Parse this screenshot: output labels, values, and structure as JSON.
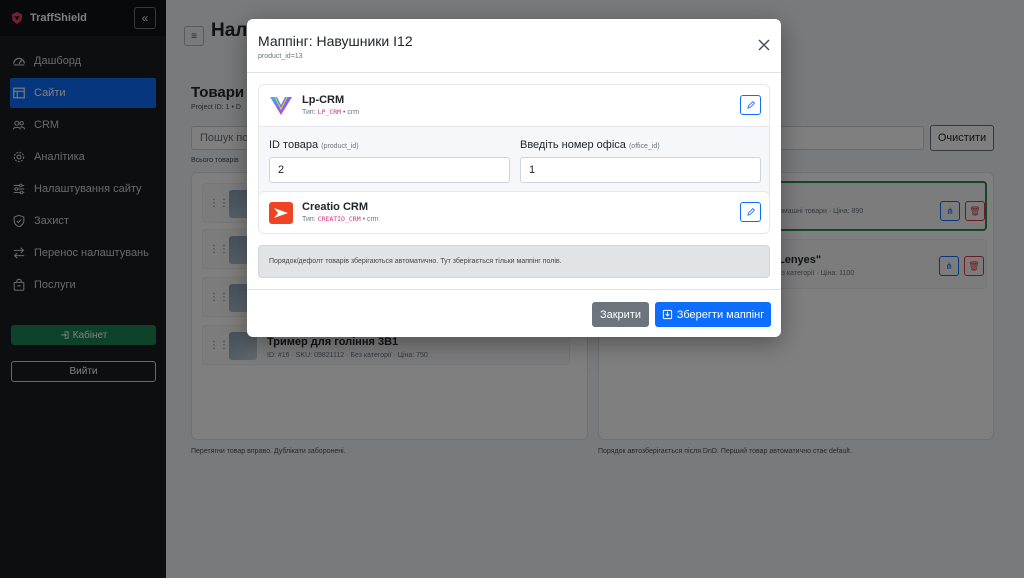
{
  "brand": {
    "name": "TraffShield",
    "collapse": "«"
  },
  "sidebar": {
    "items": [
      {
        "label": "Дашборд",
        "icon": "dashboard-icon"
      },
      {
        "label": "Сайти",
        "icon": "table-icon",
        "active": true
      },
      {
        "label": "CRM",
        "icon": "users-icon"
      },
      {
        "label": "Аналітика",
        "icon": "gear-icon"
      },
      {
        "label": "Налаштування сайту",
        "icon": "sliders-icon"
      },
      {
        "label": "Захист",
        "icon": "shield-icon"
      },
      {
        "label": "Перенос налаштувань",
        "icon": "transfer-icon"
      },
      {
        "label": "Послуги",
        "icon": "bag-icon"
      }
    ],
    "cabinet_label": "Кабінет",
    "logout_label": "Вийти"
  },
  "main": {
    "menu_glyph": "≡",
    "page_title": "Нала",
    "section_title": "Товари",
    "project_meta": "Project ID: 1 • D",
    "search_placeholder": "Пошук по",
    "clear_label": "Очистити",
    "total_text": "Всього товарів",
    "left_note": "Перетягни товар вправо. Дублікати заборонені.",
    "right_note": "Порядок автозберігається після DnD. Перший товар автоматично стає default.",
    "left_products": [
      {
        "name": "",
        "meta": ""
      },
      {
        "name": "",
        "meta": ""
      },
      {
        "name": "",
        "meta": ""
      },
      {
        "name": "Тример для гоління 3В1",
        "meta": "ID: #16   ·   SKU: 09821112   ·   Без категорії   ·   Ціна: 750"
      }
    ],
    "right_products": [
      {
        "name": "",
        "meta": "омашні товари   ·   Ціна: 890"
      },
      {
        "name": "Lenyes\"",
        "meta": "ез категорії   ·   Ціна: 1100"
      }
    ]
  },
  "modal": {
    "title": "Маппінг: Навушники I12",
    "subtitle": "product_id=13",
    "crms": [
      {
        "name": "Lp-CRM",
        "type_prefix": "Тип:",
        "type_code": "LP_CRM",
        "type_suffix": "• crm"
      },
      {
        "name": "Creatio CRM",
        "type_prefix": "Тип:",
        "type_code": "CREATIO_CRM",
        "type_suffix": "• crm"
      }
    ],
    "fields": [
      {
        "label": "ID товара",
        "hint": "(product_id)",
        "value": "2"
      },
      {
        "label": "Введіть номер офіса",
        "hint": "(office_id)",
        "value": "1"
      }
    ],
    "info": "Порядок/дефолт товарів зберігаються автоматично. Тут зберігається тільки маппінг полів.",
    "close_label": "Закрити",
    "save_label": "Зберегти маппінг"
  },
  "colors": {
    "primary": "#0d6efd",
    "success": "#198754",
    "danger": "#dc3545",
    "sidebar": "#1a1d21"
  }
}
